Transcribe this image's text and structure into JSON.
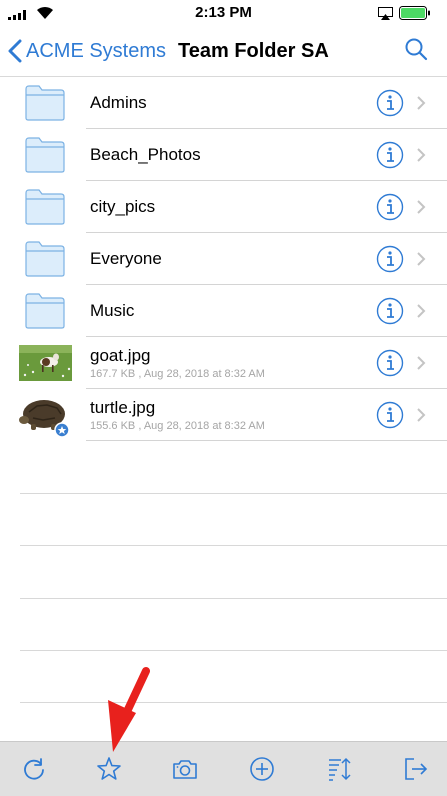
{
  "status_bar": {
    "time": "2:13 PM"
  },
  "nav": {
    "back_label": "ACME Systems",
    "title": "Team Folder SA"
  },
  "colors": {
    "accent": "#2f7bd4",
    "toolbar_bg": "#e0e0e0",
    "battery": "#4cd964",
    "arrow": "#e8211d",
    "folder_fill": "#dcedfb",
    "folder_stroke": "#7cb2e4"
  },
  "items": [
    {
      "type": "folder",
      "name": "Admins",
      "icon": "folder-icon"
    },
    {
      "type": "folder",
      "name": "Beach_Photos",
      "icon": "folder-icon"
    },
    {
      "type": "folder",
      "name": "city_pics",
      "icon": "folder-icon"
    },
    {
      "type": "folder",
      "name": "Everyone",
      "icon": "folder-icon"
    },
    {
      "type": "folder",
      "name": "Music",
      "icon": "folder-icon"
    },
    {
      "type": "file",
      "name": "goat.jpg",
      "meta": "167.7 KB , Aug 28, 2018 at 8:32 AM",
      "icon": "goat-thumbnail"
    },
    {
      "type": "file",
      "name": "turtle.jpg",
      "meta": "155.6 KB , Aug 28, 2018 at 8:32 AM",
      "icon": "turtle-thumbnail",
      "favorite": true
    }
  ],
  "toolbar": {
    "buttons": [
      "refresh-icon",
      "star-icon",
      "camera-icon",
      "add-icon",
      "sort-icon",
      "logout-icon"
    ]
  }
}
